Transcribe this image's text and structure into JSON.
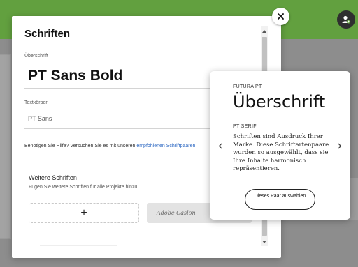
{
  "modal": {
    "title": "Schriften",
    "heading_field": {
      "label": "Überschrift",
      "value": "PT Sans Bold"
    },
    "body_field": {
      "label": "Textkörper",
      "value": "PT Sans"
    },
    "help": {
      "text": "Benötigen Sie Hilfe? Versuchen Sie es mit unseren ",
      "link": "empfohlenen Schriftpaaren"
    },
    "more_fonts": {
      "title": "Weitere Schriften",
      "subtitle": "Fügen Sie weitere Schriften für alle Projekte hinzu",
      "add_symbol": "+",
      "font_card": "Adobe Caslon"
    }
  },
  "popover": {
    "heading_font_label": "FUTURA PT",
    "heading_sample": "Überschrift",
    "body_font_label": "PT SERIF",
    "body_sample": "Schriften sind Ausdruck Ihrer Marke. Diese Schriftartenpaare wurden so ausgewählt, dass sie Ihre Inhalte harmonisch repräsentieren.",
    "select_button": "Dieses Paar auswählen"
  },
  "colors": {
    "topbar": "#62a03f",
    "link": "#2b67c2",
    "overlay": "#8d8d8d"
  },
  "icons": {
    "close": "close-icon",
    "avatar": "user-add-icon",
    "prev": "chevron-left-icon",
    "next": "chevron-right-icon"
  }
}
